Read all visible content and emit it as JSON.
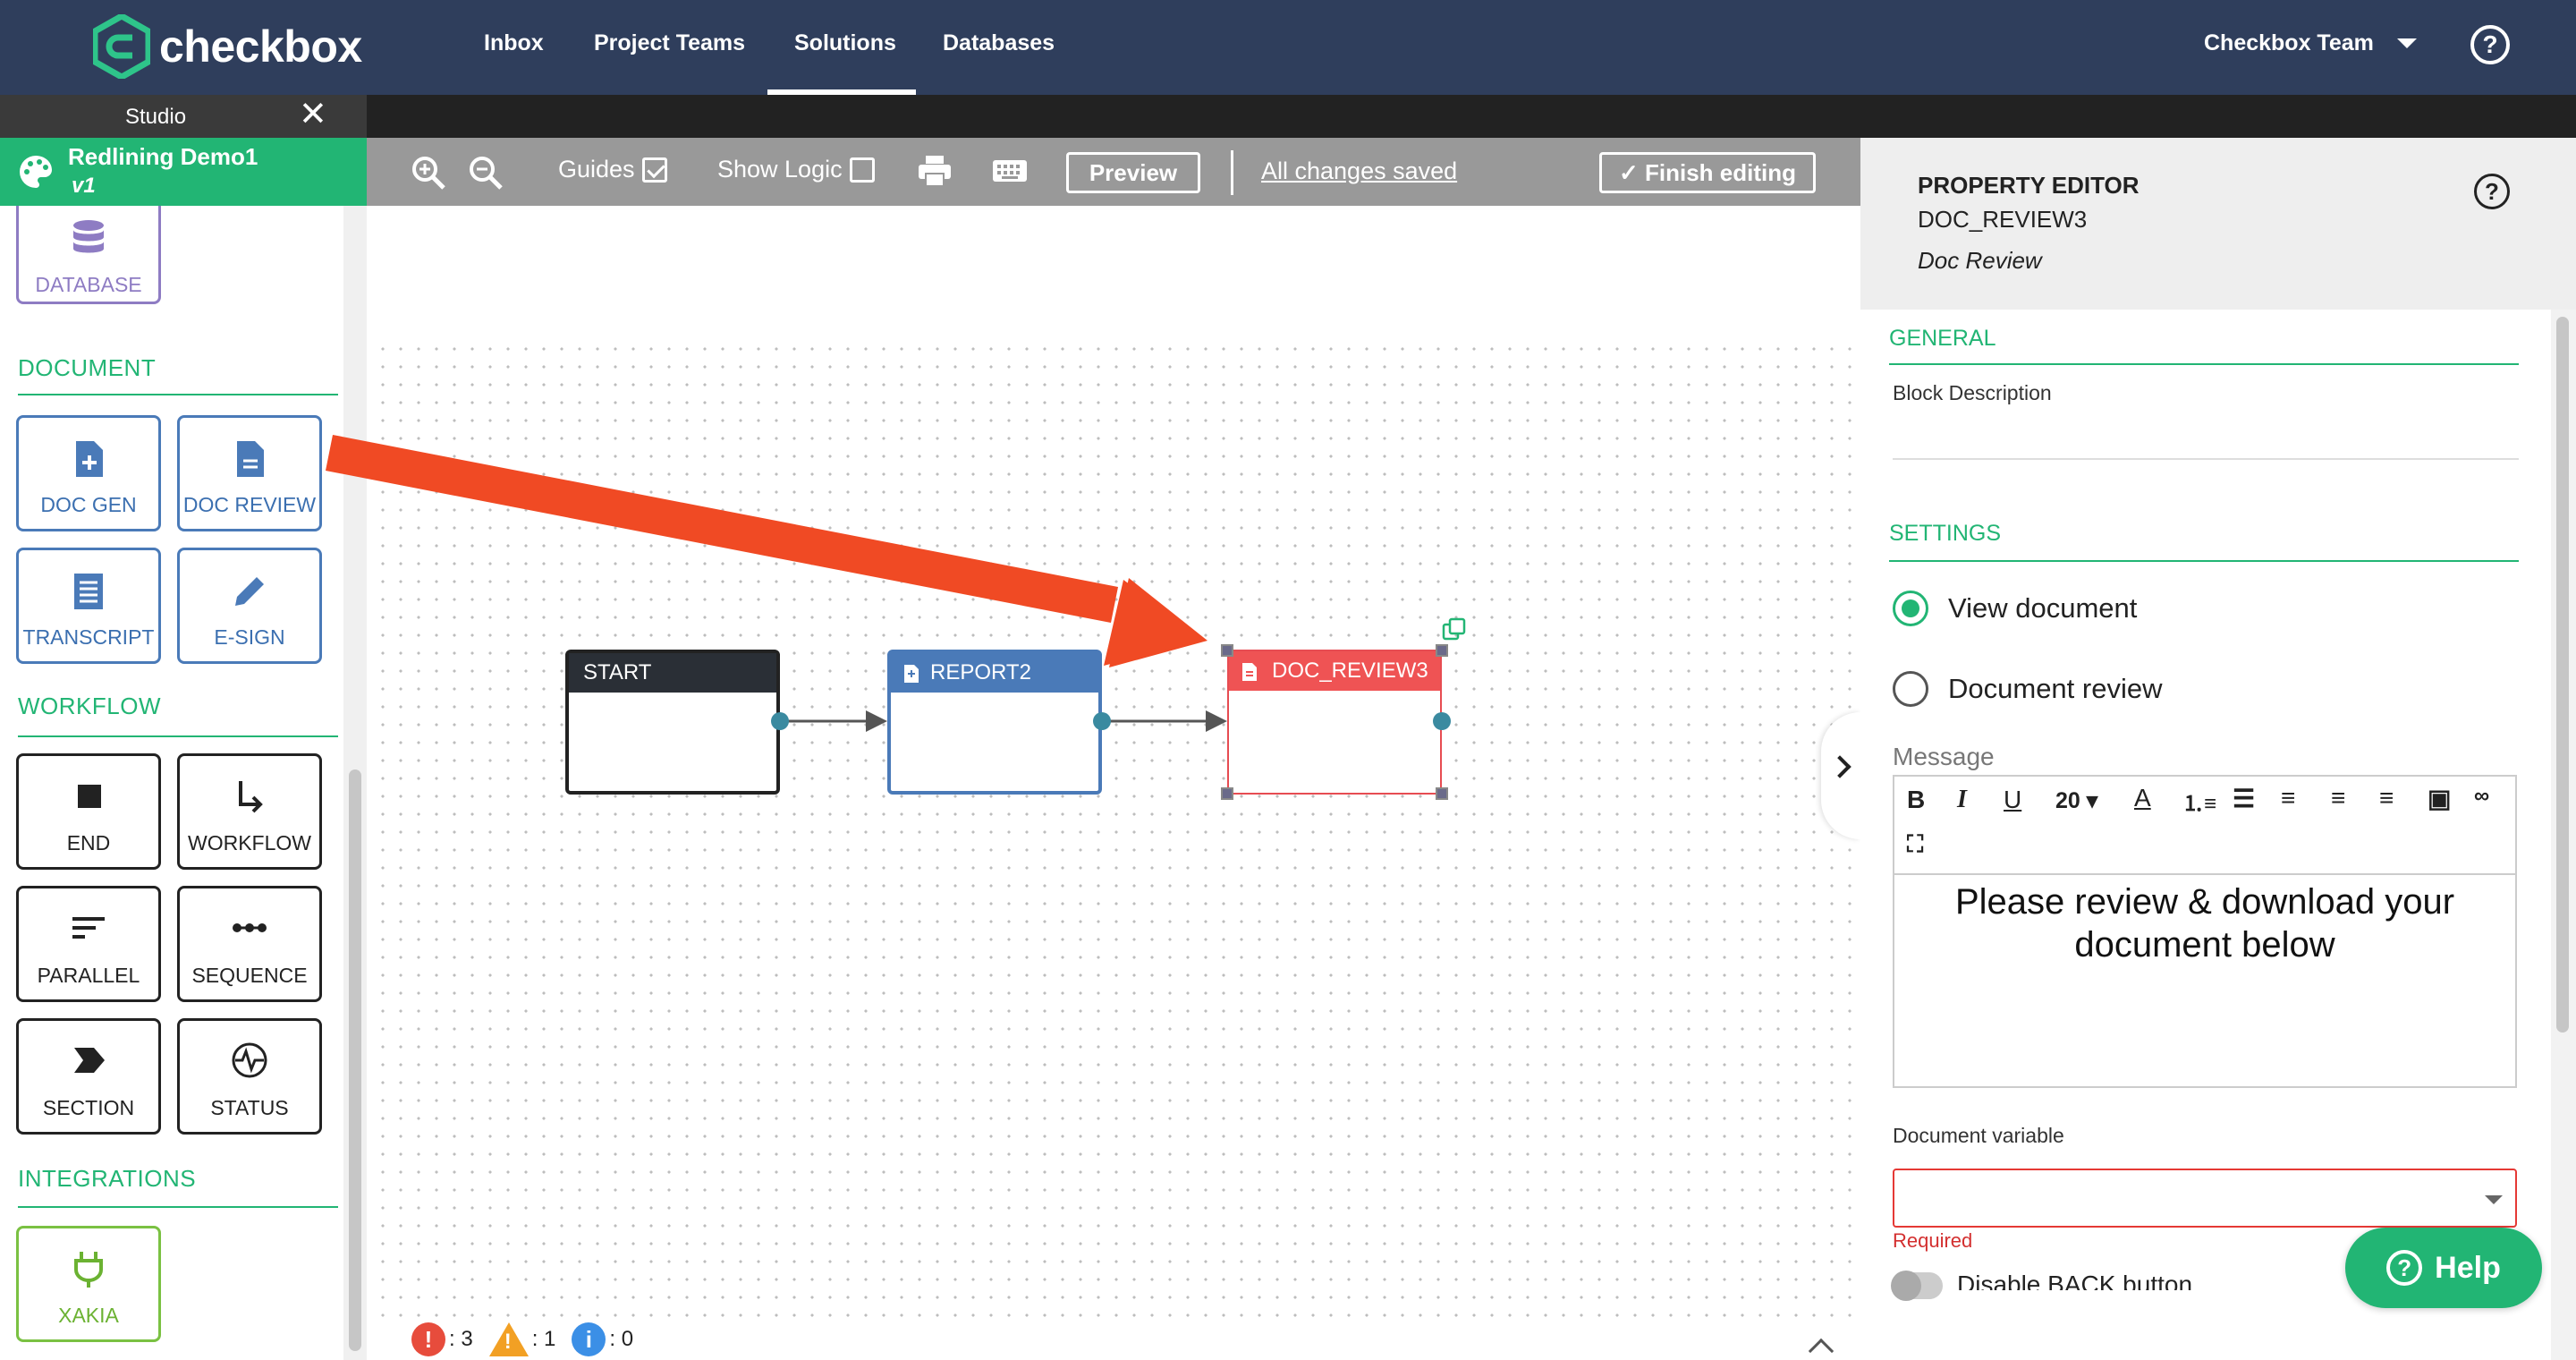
{
  "app": {
    "logo_text": "checkbox",
    "nav": [
      "Inbox",
      "Project Teams",
      "Solutions",
      "Databases"
    ],
    "active_nav": "Solutions",
    "team": "Checkbox Team",
    "help_glyph": "?"
  },
  "studio": {
    "tab_label": "Studio",
    "close_glyph": "✕",
    "project_name": "Redlining Demo1",
    "project_version": "v1"
  },
  "toolbar": {
    "guides_label": "Guides",
    "guides_checked": true,
    "show_logic_label": "Show Logic",
    "show_logic_checked": false,
    "preview_label": "Preview",
    "saved_label": "All changes saved",
    "finish_label": "Finish editing",
    "icons": [
      "zoom-in-icon",
      "zoom-out-icon",
      "print-icon",
      "keyboard-icon",
      "check-icon"
    ]
  },
  "sidebar": {
    "database_label": "DATABASE",
    "sections": {
      "document": "DOCUMENT",
      "workflow": "WORKFLOW",
      "integrations": "INTEGRATIONS"
    },
    "document_blocks": [
      "DOC GEN",
      "DOC REVIEW",
      "TRANSCRIPT",
      "E-SIGN"
    ],
    "workflow_blocks": [
      "END",
      "WORKFLOW",
      "PARALLEL",
      "SEQUENCE",
      "SECTION",
      "STATUS"
    ],
    "integration_blocks": [
      "XAKIA"
    ]
  },
  "canvas": {
    "nodes": [
      {
        "id": "start",
        "label": "START"
      },
      {
        "id": "report",
        "label": "REPORT2"
      },
      {
        "id": "review",
        "label": "DOC_REVIEW3"
      }
    ],
    "status": {
      "errors": ": 3",
      "warnings": ": 1",
      "info": ": 0"
    }
  },
  "property_editor": {
    "title": "PROPERTY EDITOR",
    "block_id": "DOC_REVIEW3",
    "block_type": "Doc Review",
    "general_label": "GENERAL",
    "block_description_label": "Block Description",
    "settings_label": "SETTINGS",
    "options": [
      "View document",
      "Document review"
    ],
    "selected_option": "View document",
    "message_label": "Message",
    "font_size": "20",
    "message_line1": "Please review & download your",
    "message_line2": "document below",
    "document_variable_label": "Document variable",
    "required_label": "Required",
    "disable_back_label": "Disable BACK button"
  },
  "help_button": "Help",
  "colors": {
    "nav_bg": "#2f3e5c",
    "brand_green": "#22b574",
    "doc_blue": "#4a7ab8",
    "review_red": "#ef5354",
    "arrow_red": "#f04a24"
  }
}
